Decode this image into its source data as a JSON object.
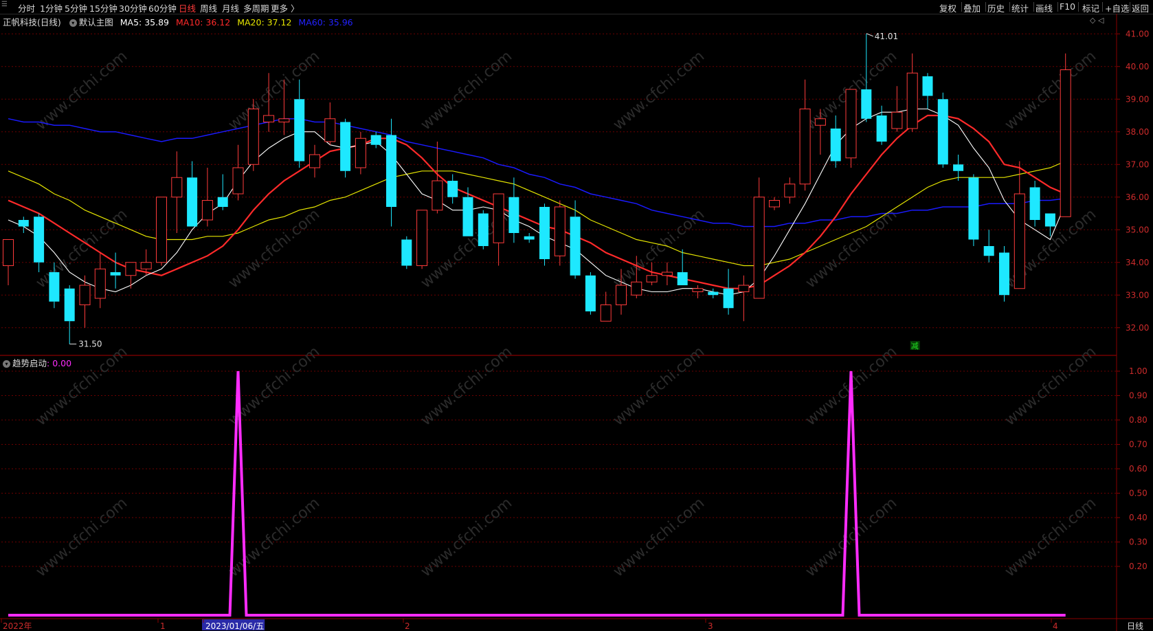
{
  "toolbar": {
    "periods": [
      "分时",
      "1分钟",
      "5分钟",
      "15分钟",
      "30分钟",
      "60分钟",
      "日线",
      "周线",
      "月线",
      "多周期",
      "更多 〉"
    ],
    "active_period": "日线",
    "right_buttons": [
      "复权",
      "叠加",
      "历史",
      "统计",
      "画线",
      "F10",
      "标记",
      "+自选",
      "返回"
    ]
  },
  "main_panel": {
    "title": "正帆科技(日线)",
    "template": "默认主图",
    "ma5_label": "MA5: 35.89",
    "ma10_label": "MA10: 36.12",
    "ma20_label": "MA20: 37.12",
    "ma60_label": "MA60: 35.96",
    "high_marker": "41.01",
    "low_marker": "31.50",
    "signal_mark": "减"
  },
  "sub_panel": {
    "title": "趋势启动",
    "value": ": 0.00"
  },
  "x_axis": {
    "labels": [
      "2022年",
      "1",
      "2023/01/06/五",
      "2",
      "3",
      "4"
    ],
    "period_label": "日线"
  },
  "watermark": "www.cfchi.com",
  "colors": {
    "up": "#ff3b3b",
    "down": "#1ee8ff",
    "ma5": "#ffffff",
    "ma10": "#ff2a2a",
    "ma20": "#e6e600",
    "ma60": "#1a1aff",
    "indicator": "#ff2cff",
    "grid": "#6e0000"
  },
  "chart_data": [
    {
      "type": "candlestick",
      "title": "正帆科技(日线)",
      "ylim": [
        31.2,
        41.3
      ],
      "y_ticks": [
        32.0,
        33.0,
        34.0,
        35.0,
        36.0,
        37.0,
        38.0,
        39.0,
        40.0,
        41.0
      ],
      "candles": [
        {
          "o": 33.9,
          "h": 34.6,
          "l": 33.3,
          "c": 34.7
        },
        {
          "o": 35.3,
          "h": 35.4,
          "l": 34.9,
          "c": 35.1
        },
        {
          "o": 35.4,
          "h": 35.5,
          "l": 33.7,
          "c": 34.0
        },
        {
          "o": 33.7,
          "h": 34.0,
          "l": 32.6,
          "c": 32.8
        },
        {
          "o": 33.2,
          "h": 33.3,
          "l": 31.5,
          "c": 32.2
        },
        {
          "o": 32.7,
          "h": 33.6,
          "l": 32.0,
          "c": 33.3
        },
        {
          "o": 32.9,
          "h": 34.3,
          "l": 32.6,
          "c": 33.8
        },
        {
          "o": 33.7,
          "h": 34.3,
          "l": 33.2,
          "c": 33.6
        },
        {
          "o": 33.6,
          "h": 34.0,
          "l": 33.2,
          "c": 34.0
        },
        {
          "o": 33.8,
          "h": 34.4,
          "l": 33.6,
          "c": 34.0
        },
        {
          "o": 34.0,
          "h": 35.2,
          "l": 33.9,
          "c": 36.0
        },
        {
          "o": 36.0,
          "h": 37.4,
          "l": 34.9,
          "c": 36.6
        },
        {
          "o": 36.6,
          "h": 37.1,
          "l": 35.1,
          "c": 35.1
        },
        {
          "o": 35.3,
          "h": 36.9,
          "l": 35.1,
          "c": 35.9
        },
        {
          "o": 36.0,
          "h": 36.7,
          "l": 35.6,
          "c": 35.7
        },
        {
          "o": 36.1,
          "h": 37.6,
          "l": 35.9,
          "c": 36.9
        },
        {
          "o": 37.0,
          "h": 39.0,
          "l": 36.8,
          "c": 38.7
        },
        {
          "o": 38.3,
          "h": 39.8,
          "l": 38.0,
          "c": 38.5
        },
        {
          "o": 38.3,
          "h": 39.6,
          "l": 37.9,
          "c": 38.4
        },
        {
          "o": 39.0,
          "h": 39.6,
          "l": 36.9,
          "c": 37.1
        },
        {
          "o": 36.9,
          "h": 37.6,
          "l": 36.6,
          "c": 37.3
        },
        {
          "o": 37.7,
          "h": 38.9,
          "l": 37.6,
          "c": 38.4
        },
        {
          "o": 38.3,
          "h": 38.4,
          "l": 36.6,
          "c": 36.8
        },
        {
          "o": 36.9,
          "h": 38.0,
          "l": 36.7,
          "c": 37.8
        },
        {
          "o": 37.9,
          "h": 38.0,
          "l": 37.5,
          "c": 37.6
        },
        {
          "o": 37.9,
          "h": 38.4,
          "l": 35.1,
          "c": 35.7
        },
        {
          "o": 34.7,
          "h": 34.8,
          "l": 33.8,
          "c": 33.9
        },
        {
          "o": 33.9,
          "h": 35.0,
          "l": 33.8,
          "c": 35.6
        },
        {
          "o": 35.6,
          "h": 37.7,
          "l": 35.5,
          "c": 36.5
        },
        {
          "o": 36.5,
          "h": 36.7,
          "l": 35.8,
          "c": 36.0
        },
        {
          "o": 36.0,
          "h": 36.3,
          "l": 34.8,
          "c": 34.8
        },
        {
          "o": 35.5,
          "h": 35.6,
          "l": 34.4,
          "c": 34.5
        },
        {
          "o": 34.6,
          "h": 36.0,
          "l": 33.9,
          "c": 36.1
        },
        {
          "o": 36.0,
          "h": 36.6,
          "l": 34.6,
          "c": 34.9
        },
        {
          "o": 34.8,
          "h": 34.9,
          "l": 34.6,
          "c": 34.7
        },
        {
          "o": 35.7,
          "h": 35.8,
          "l": 33.9,
          "c": 34.1
        },
        {
          "o": 34.2,
          "h": 35.9,
          "l": 33.9,
          "c": 35.7
        },
        {
          "o": 35.4,
          "h": 35.9,
          "l": 33.5,
          "c": 33.6
        },
        {
          "o": 33.6,
          "h": 33.7,
          "l": 32.4,
          "c": 32.5
        },
        {
          "o": 32.2,
          "h": 33.1,
          "l": 32.2,
          "c": 32.7
        },
        {
          "o": 32.7,
          "h": 33.8,
          "l": 32.4,
          "c": 33.3
        },
        {
          "o": 33.0,
          "h": 34.2,
          "l": 32.9,
          "c": 33.4
        },
        {
          "o": 33.4,
          "h": 34.0,
          "l": 33.3,
          "c": 33.6
        },
        {
          "o": 33.6,
          "h": 34.0,
          "l": 33.3,
          "c": 33.7
        },
        {
          "o": 33.7,
          "h": 34.4,
          "l": 33.3,
          "c": 33.3
        },
        {
          "o": 33.1,
          "h": 33.3,
          "l": 32.9,
          "c": 33.2
        },
        {
          "o": 33.1,
          "h": 33.2,
          "l": 32.9,
          "c": 33.0
        },
        {
          "o": 33.2,
          "h": 33.8,
          "l": 32.4,
          "c": 32.6
        },
        {
          "o": 33.1,
          "h": 33.6,
          "l": 32.2,
          "c": 33.3
        },
        {
          "o": 32.9,
          "h": 36.6,
          "l": 32.9,
          "c": 36.0
        },
        {
          "o": 35.7,
          "h": 36.0,
          "l": 35.6,
          "c": 35.9
        },
        {
          "o": 36.0,
          "h": 36.6,
          "l": 35.8,
          "c": 36.4
        },
        {
          "o": 36.4,
          "h": 39.6,
          "l": 36.2,
          "c": 38.7
        },
        {
          "o": 38.2,
          "h": 38.7,
          "l": 37.3,
          "c": 38.4
        },
        {
          "o": 38.1,
          "h": 38.5,
          "l": 36.9,
          "c": 37.1
        },
        {
          "o": 37.2,
          "h": 39.2,
          "l": 36.9,
          "c": 39.3
        },
        {
          "o": 39.3,
          "h": 41.0,
          "l": 38.3,
          "c": 38.4
        },
        {
          "o": 38.5,
          "h": 38.8,
          "l": 37.6,
          "c": 37.7
        },
        {
          "o": 38.1,
          "h": 39.4,
          "l": 38.0,
          "c": 38.6
        },
        {
          "o": 38.1,
          "h": 40.4,
          "l": 38.0,
          "c": 39.8
        },
        {
          "o": 39.7,
          "h": 39.8,
          "l": 38.7,
          "c": 39.1
        },
        {
          "o": 39.0,
          "h": 39.2,
          "l": 36.9,
          "c": 37.0
        },
        {
          "o": 37.0,
          "h": 37.3,
          "l": 36.5,
          "c": 36.8
        },
        {
          "o": 36.6,
          "h": 36.7,
          "l": 34.5,
          "c": 34.7
        },
        {
          "o": 34.5,
          "h": 35.0,
          "l": 34.0,
          "c": 34.2
        },
        {
          "o": 34.3,
          "h": 34.5,
          "l": 32.8,
          "c": 33.0
        },
        {
          "o": 33.2,
          "h": 37.1,
          "l": 33.2,
          "c": 36.1
        },
        {
          "o": 36.3,
          "h": 36.5,
          "l": 35.1,
          "c": 35.3
        },
        {
          "o": 35.5,
          "h": 35.5,
          "l": 34.8,
          "c": 35.1
        },
        {
          "o": 35.4,
          "h": 40.4,
          "l": 35.4,
          "c": 39.9
        }
      ],
      "ma5": [
        35.3,
        35.1,
        34.8,
        34.3,
        33.7,
        33.4,
        33.2,
        33.1,
        33.3,
        33.6,
        33.8,
        34.3,
        35.0,
        35.5,
        35.8,
        36.5,
        37.1,
        37.5,
        37.8,
        38.0,
        38.0,
        37.6,
        37.5,
        37.6,
        37.7,
        37.3,
        36.7,
        36.1,
        35.9,
        35.6,
        35.6,
        35.7,
        35.6,
        35.3,
        35.1,
        34.8,
        34.6,
        34.4,
        34.0,
        33.6,
        33.4,
        33.2,
        33.1,
        33.1,
        33.2,
        33.2,
        33.1,
        33.0,
        33.1,
        33.5,
        34.2,
        35.0,
        35.8,
        36.7,
        37.6,
        38.1,
        38.4,
        38.6,
        38.6,
        38.7,
        38.7,
        38.5,
        38.2,
        37.5,
        36.9,
        35.9,
        35.3,
        35.0,
        34.7,
        35.8
      ],
      "ma10": [
        35.9,
        35.7,
        35.5,
        35.2,
        34.9,
        34.6,
        34.3,
        34.0,
        33.8,
        33.7,
        33.6,
        33.8,
        34.0,
        34.2,
        34.5,
        35.0,
        35.6,
        36.1,
        36.5,
        36.8,
        37.1,
        37.4,
        37.5,
        37.6,
        37.8,
        37.8,
        37.6,
        37.2,
        36.7,
        36.3,
        36.1,
        35.9,
        35.7,
        35.5,
        35.3,
        35.1,
        35.0,
        34.8,
        34.6,
        34.3,
        34.1,
        33.9,
        33.7,
        33.6,
        33.5,
        33.4,
        33.3,
        33.2,
        33.2,
        33.3,
        33.6,
        33.9,
        34.3,
        34.8,
        35.4,
        36.1,
        36.7,
        37.3,
        37.8,
        38.2,
        38.5,
        38.5,
        38.4,
        38.1,
        37.7,
        37.0,
        36.9,
        36.6,
        36.3,
        36.1
      ],
      "ma20": [
        36.8,
        36.6,
        36.4,
        36.1,
        35.9,
        35.6,
        35.4,
        35.2,
        35.0,
        34.8,
        34.7,
        34.7,
        34.7,
        34.8,
        34.8,
        34.9,
        35.1,
        35.3,
        35.4,
        35.6,
        35.7,
        35.9,
        36.0,
        36.2,
        36.4,
        36.6,
        36.7,
        36.8,
        36.8,
        36.8,
        36.7,
        36.6,
        36.5,
        36.4,
        36.2,
        36.0,
        35.8,
        35.6,
        35.3,
        35.1,
        34.9,
        34.7,
        34.6,
        34.5,
        34.3,
        34.2,
        34.1,
        34.0,
        33.9,
        33.9,
        34.0,
        34.1,
        34.3,
        34.5,
        34.7,
        34.9,
        35.1,
        35.4,
        35.7,
        36.0,
        36.3,
        36.5,
        36.6,
        36.6,
        36.6,
        36.6,
        36.7,
        36.8,
        36.9,
        37.1
      ],
      "ma60": [
        38.4,
        38.3,
        38.3,
        38.2,
        38.2,
        38.1,
        38.0,
        38.0,
        37.9,
        37.8,
        37.7,
        37.8,
        37.8,
        37.9,
        38.0,
        38.1,
        38.2,
        38.3,
        38.4,
        38.4,
        38.3,
        38.3,
        38.2,
        38.1,
        38.0,
        37.9,
        37.7,
        37.6,
        37.5,
        37.4,
        37.3,
        37.2,
        37.0,
        36.9,
        36.7,
        36.6,
        36.4,
        36.3,
        36.1,
        36.0,
        35.9,
        35.8,
        35.6,
        35.5,
        35.4,
        35.3,
        35.2,
        35.2,
        35.1,
        35.1,
        35.1,
        35.2,
        35.2,
        35.3,
        35.3,
        35.4,
        35.4,
        35.5,
        35.5,
        35.6,
        35.6,
        35.7,
        35.7,
        35.7,
        35.8,
        35.8,
        35.8,
        35.9,
        35.9,
        35.96
      ]
    },
    {
      "type": "line",
      "title": "趋势启动",
      "ylim": [
        0,
        1.0
      ],
      "y_ticks": [
        0.2,
        0.3,
        0.4,
        0.5,
        0.6,
        0.7,
        0.8,
        0.9,
        1.0
      ],
      "series": [
        {
          "name": "趋势启动",
          "values": [
            0,
            0,
            0,
            0,
            0,
            0,
            0,
            0,
            0,
            0,
            0,
            0,
            0,
            0,
            0,
            1,
            0,
            0,
            0,
            0,
            0,
            0,
            0,
            0,
            0,
            0,
            0,
            0,
            0,
            0,
            0,
            0,
            0,
            0,
            0,
            0,
            0,
            0,
            0,
            0,
            0,
            0,
            0,
            0,
            0,
            0,
            0,
            0,
            0,
            0,
            0,
            0,
            0,
            0,
            0,
            1,
            0,
            0,
            0,
            0,
            0,
            0,
            0,
            0,
            0,
            0,
            0,
            0,
            0,
            0
          ]
        }
      ]
    }
  ]
}
